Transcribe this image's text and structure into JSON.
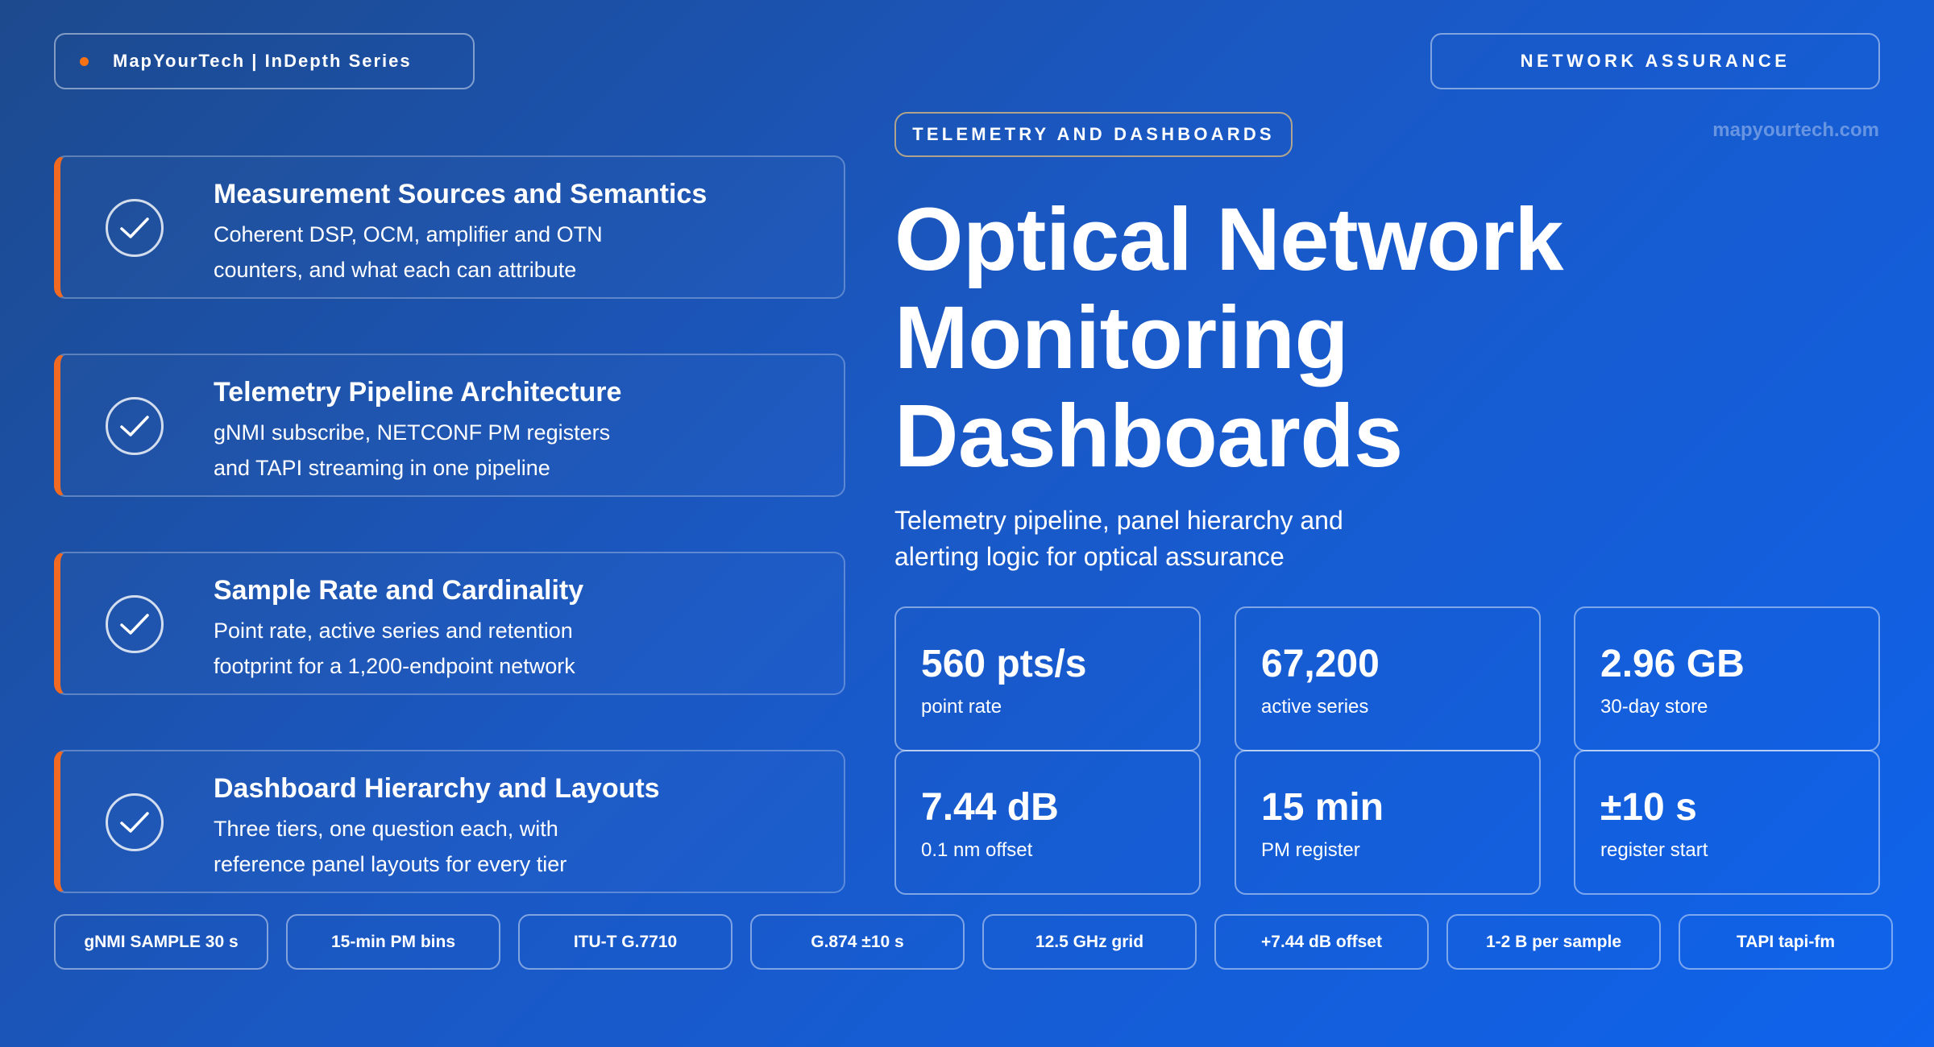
{
  "header": {
    "brand": "MapYourTech | InDepth Series",
    "section": "NETWORK ASSURANCE",
    "topic": "TELEMETRY AND DASHBOARDS",
    "site": "mapyourtech.com"
  },
  "cards": [
    {
      "title": "Measurement Sources and Semantics",
      "line1": "Coherent DSP, OCM, amplifier and OTN",
      "line2": "counters, and what each can attribute"
    },
    {
      "title": "Telemetry Pipeline Architecture",
      "line1": "gNMI subscribe, NETCONF PM registers",
      "line2": "and TAPI streaming in one pipeline"
    },
    {
      "title": "Sample Rate and Cardinality",
      "line1": "Point rate, active series and retention",
      "line2": "footprint for a 1,200-endpoint network"
    },
    {
      "title": "Dashboard Hierarchy and Layouts",
      "line1": "Three tiers, one question each, with",
      "line2": "reference panel layouts for every tier"
    }
  ],
  "main": {
    "title_line1": "Optical Network",
    "title_line2": "Monitoring",
    "title_line3": "Dashboards",
    "subtitle_line1": "Telemetry pipeline, panel hierarchy and",
    "subtitle_line2": "alerting logic for optical assurance"
  },
  "stats": [
    {
      "value": "560 pts/s",
      "label": "point rate"
    },
    {
      "value": "67,200",
      "label": "active series"
    },
    {
      "value": "2.96 GB",
      "label": "30-day store"
    },
    {
      "value": "7.44 dB",
      "label": "0.1 nm offset"
    },
    {
      "value": "15 min",
      "label": "PM register"
    },
    {
      "value": "±10 s",
      "label": "register start"
    }
  ],
  "chips": [
    "gNMI SAMPLE 30 s",
    "15-min PM bins",
    "ITU-T G.7710",
    "G.874 ±10 s",
    "12.5 GHz grid",
    "+7.44 dB offset",
    "1-2 B per sample",
    "TAPI tapi-fm"
  ],
  "colors": {
    "accent": "#f26a21",
    "background_start": "#1d4a8e",
    "background_end": "#0f63ec"
  }
}
